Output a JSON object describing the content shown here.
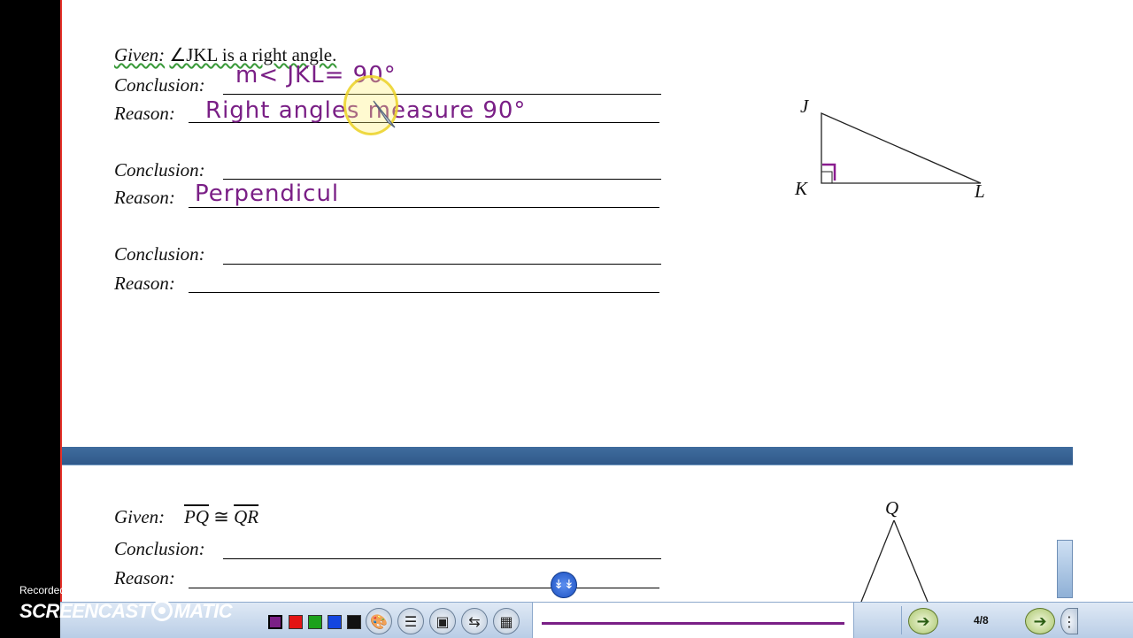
{
  "section1": {
    "given_label": "Given:",
    "given_text": "∠JKL is a right angle.",
    "rows": [
      {
        "conclusion_label": "Conclusion:",
        "reason_label": "Reason:",
        "conclusion_hw": "m< JKL= 90°",
        "reason_hw": "Right angles measure 90°"
      },
      {
        "conclusion_label": "Conclusion:",
        "reason_label": "Reason:",
        "conclusion_hw": "",
        "reason_hw": "Perpendicul"
      },
      {
        "conclusion_label": "Conclusion:",
        "reason_label": "Reason:",
        "conclusion_hw": "",
        "reason_hw": ""
      }
    ],
    "diagram": {
      "vertex_j": "J",
      "vertex_k": "K",
      "vertex_l": "L"
    }
  },
  "section2": {
    "given_label": "Given:",
    "given_seg1": "PQ",
    "congruent": "≅",
    "given_seg2": "QR",
    "conclusion_label": "Conclusion:",
    "reason_label": "Reason:",
    "diagram": {
      "vertex_q": "Q"
    }
  },
  "toolbar": {
    "colors": [
      "#7a1f86",
      "#e31414",
      "#1ca11c",
      "#1446e0",
      "#111111"
    ],
    "pen_color": "#7a1f86",
    "page_indicator": "4/8",
    "icons": [
      "palette-icon",
      "line-width-icon",
      "screenshot-icon",
      "swap-icon",
      "grid-icon"
    ]
  },
  "watermark": {
    "small": "Recorded with",
    "big": "SCREENCAST",
    "big_suffix": "MATIC"
  }
}
